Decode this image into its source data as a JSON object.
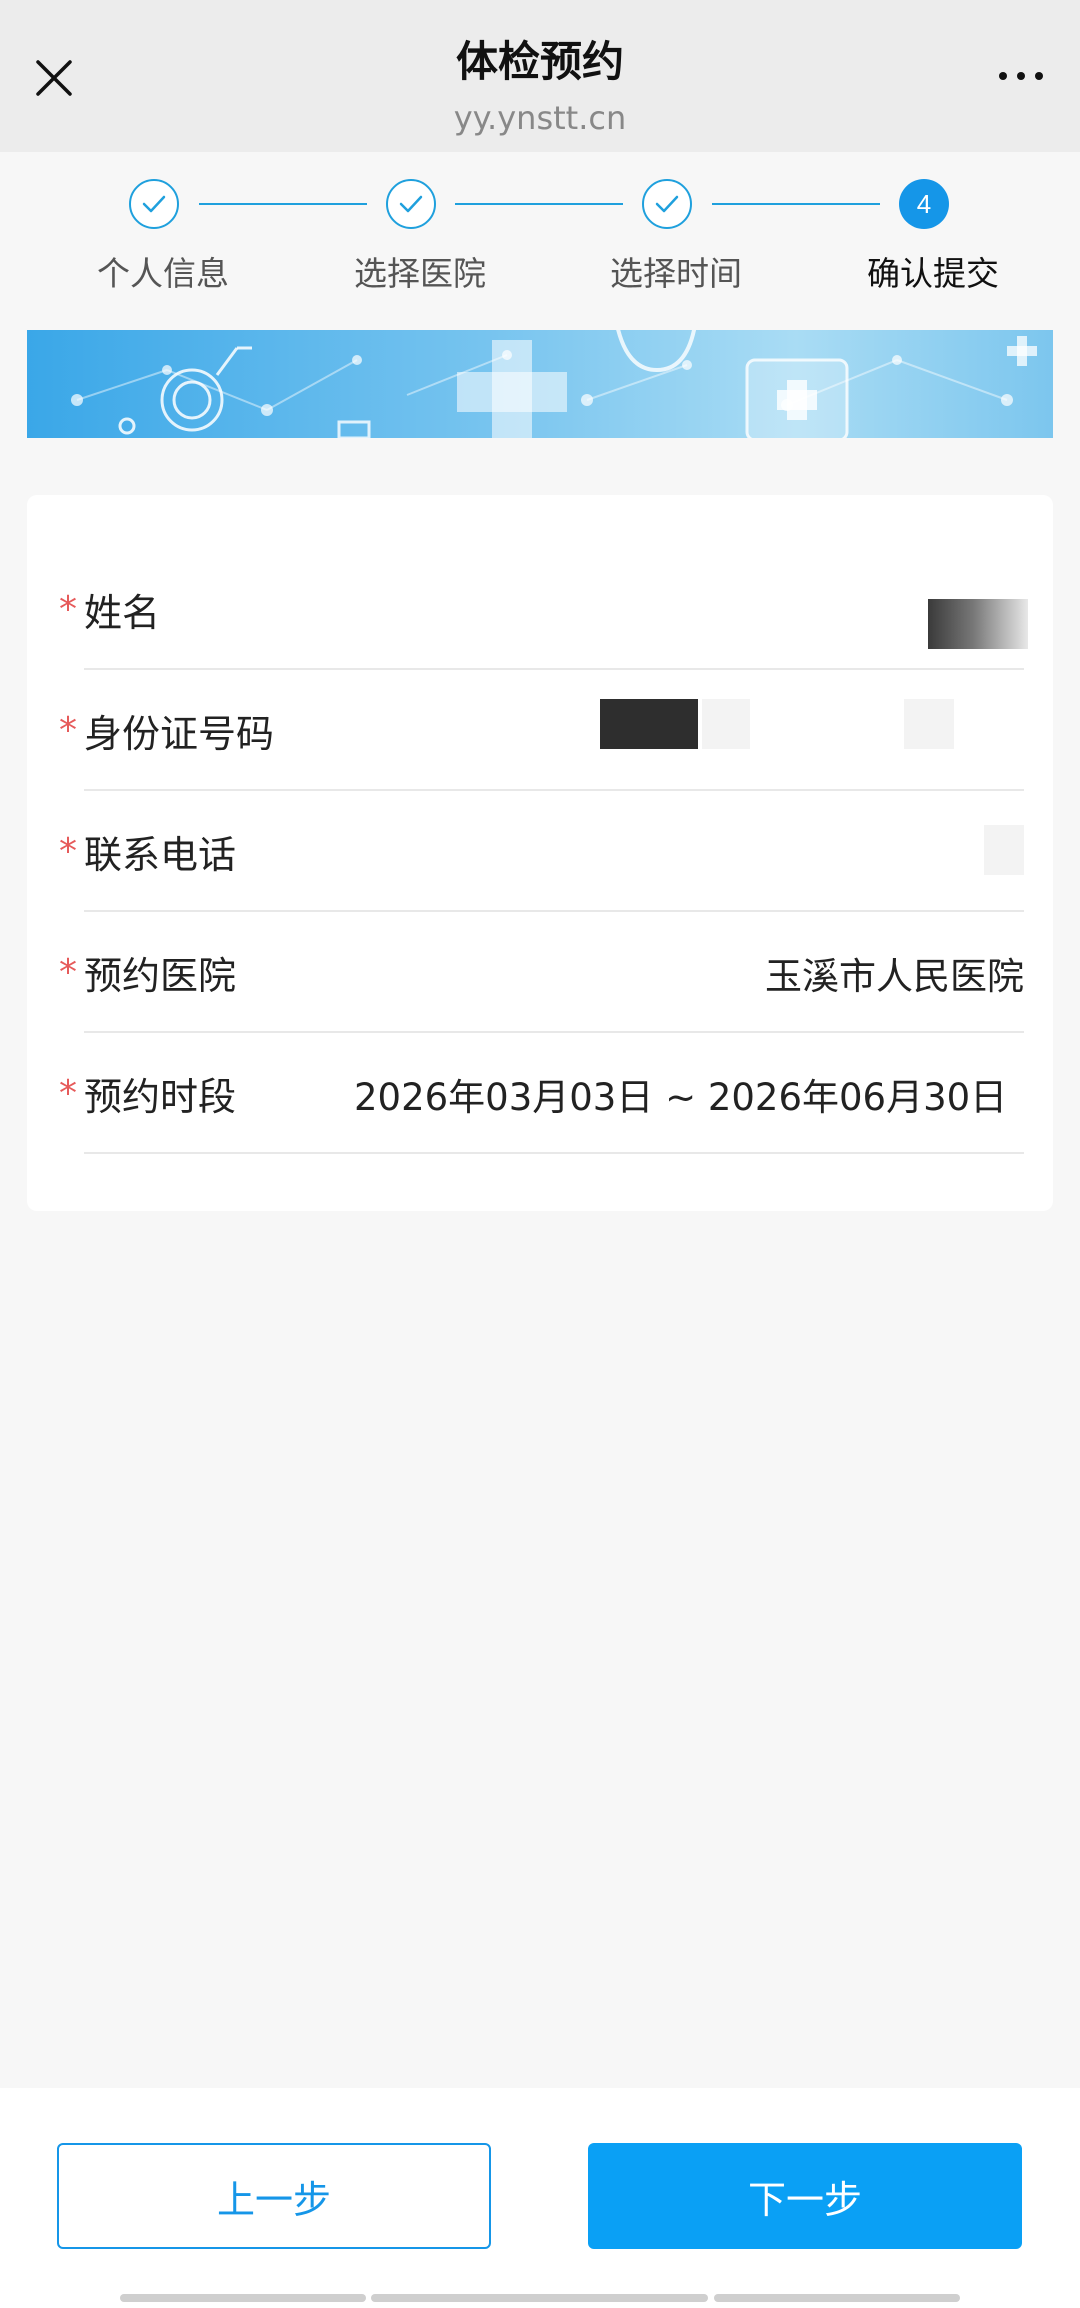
{
  "header": {
    "title": "体检预约",
    "subtitle": "yy.ynstt.cn",
    "close_icon": "close-icon",
    "more_icon": "more-icon"
  },
  "stepper": {
    "steps": [
      {
        "label": "个人信息",
        "status": "done"
      },
      {
        "label": "选择医院",
        "status": "done"
      },
      {
        "label": "选择时间",
        "status": "done"
      },
      {
        "label": "确认提交",
        "status": "current",
        "number": "4"
      }
    ],
    "accent_color": "#1596e8"
  },
  "form": {
    "required_mark": "*",
    "fields": [
      {
        "label": "姓名",
        "value": ""
      },
      {
        "label": "身份证号码",
        "value": ""
      },
      {
        "label": "联系电话",
        "value": ""
      },
      {
        "label": "预约医院",
        "value": "玉溪市人民医院"
      },
      {
        "label": "预约时段",
        "value": "2026年03月03日 ~ 2026年06月30日"
      }
    ]
  },
  "footer": {
    "prev_label": "上一步",
    "next_label": "下一步",
    "primary_color": "#0aa0f5"
  }
}
